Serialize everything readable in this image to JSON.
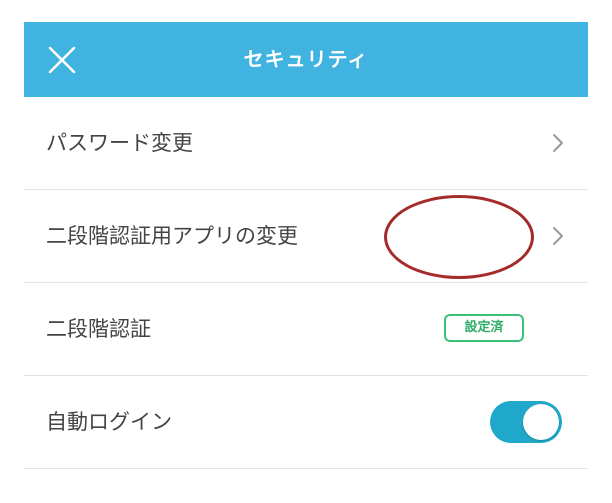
{
  "header": {
    "title": "セキュリティ",
    "close_icon": "close-icon",
    "background": "#40b3e0"
  },
  "rows": [
    {
      "label": "パスワード変更",
      "trailing": "chevron-right-icon"
    },
    {
      "label": "二段階認証用アプリの変更",
      "trailing": "chevron-right-icon"
    },
    {
      "label": "二段階認証",
      "badge": "設定済",
      "badge_color": "#3cbf7a"
    },
    {
      "label": "自動ログイン",
      "toggle": "on",
      "toggle_color": "#1fa8c9"
    }
  ],
  "annotation_color": "#a52a2a"
}
